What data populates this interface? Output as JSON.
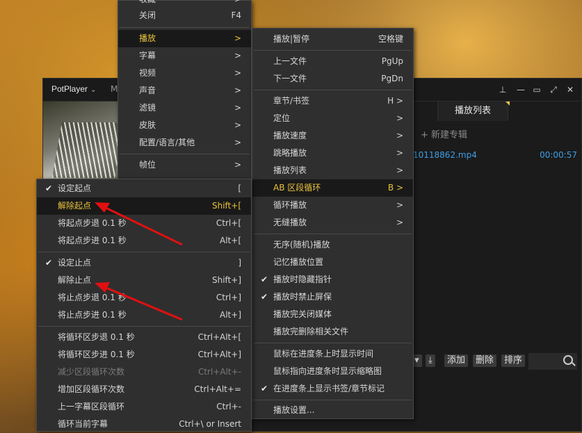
{
  "player": {
    "app_name": "PotPlayer",
    "m_tab": "M",
    "playlist_tab": "播放列表",
    "new_album": "+ 新建专辑",
    "item": {
      "name": "10118862.mp4",
      "duration": "00:00:57"
    },
    "toolbar": {
      "add": "添加",
      "delete": "删除",
      "sort": "排序"
    }
  },
  "main_menu": {
    "items": [
      {
        "label": "收藏",
        "key": ">"
      },
      {
        "label": "关闭",
        "key": "F4"
      },
      {
        "label": "播放",
        "key": ">"
      },
      {
        "label": "字幕",
        "key": ">"
      },
      {
        "label": "视频",
        "key": ">"
      },
      {
        "label": "声音",
        "key": ">"
      },
      {
        "label": "滤镜",
        "key": ">"
      },
      {
        "label": "皮肤",
        "key": ">"
      },
      {
        "label": "配置/语言/其他",
        "key": ">"
      },
      {
        "label": "帧位",
        "key": ">"
      }
    ]
  },
  "play_menu": {
    "items": [
      {
        "label": "播放|暂停",
        "key": "空格键"
      },
      {
        "label": "上一文件",
        "key": "PgUp"
      },
      {
        "label": "下一文件",
        "key": "PgDn"
      },
      {
        "label": "章节/书签",
        "key": "H >"
      },
      {
        "label": "定位",
        "key": ">"
      },
      {
        "label": "播放速度",
        "key": ">"
      },
      {
        "label": "跳略播放",
        "key": ">"
      },
      {
        "label": "播放列表",
        "key": ">"
      },
      {
        "label": "AB 区段循环",
        "key": "B >"
      },
      {
        "label": "循环播放",
        "key": ">"
      },
      {
        "label": "无缝播放",
        "key": ">"
      },
      {
        "label": "无序(随机)播放",
        "key": ""
      },
      {
        "label": "记忆播放位置",
        "key": ""
      },
      {
        "label": "播放时隐藏指针",
        "key": ""
      },
      {
        "label": "播放时禁止屏保",
        "key": ""
      },
      {
        "label": "播放完关闭媒体",
        "key": ""
      },
      {
        "label": "播放完删除相关文件",
        "key": ""
      },
      {
        "label": "鼠标在进度条上时显示时间",
        "key": ""
      },
      {
        "label": "鼠标指向进度条时显示缩略图",
        "key": ""
      },
      {
        "label": "在进度条上显示书签/章节标记",
        "key": ""
      },
      {
        "label": "播放设置...",
        "key": ""
      }
    ]
  },
  "ab_menu": {
    "items": [
      {
        "label": "设定起点",
        "key": "["
      },
      {
        "label": "解除起点",
        "key": "Shift+["
      },
      {
        "label": "将起点步退 0.1 秒",
        "key": "Ctrl+["
      },
      {
        "label": "将起点步进 0.1 秒",
        "key": "Alt+["
      },
      {
        "label": "设定止点",
        "key": "]"
      },
      {
        "label": "解除止点",
        "key": "Shift+]"
      },
      {
        "label": "将止点步退 0.1 秒",
        "key": "Ctrl+]"
      },
      {
        "label": "将止点步进 0.1 秒",
        "key": "Alt+]"
      },
      {
        "label": "将循环区步退 0.1 秒",
        "key": "Ctrl+Alt+["
      },
      {
        "label": "将循环区步进 0.1 秒",
        "key": "Ctrl+Alt+]"
      },
      {
        "label": "减少区段循环次数",
        "key": "Ctrl+Alt+-"
      },
      {
        "label": "增加区段循环次数",
        "key": "Ctrl+Alt+="
      },
      {
        "label": "上一字幕区段循环",
        "key": "Ctrl+-"
      },
      {
        "label": "循环当前字幕",
        "key": "Ctrl+\\ or Insert"
      }
    ]
  },
  "colors": {
    "highlight_text": "#e9c33d",
    "arrow": "#e01010",
    "playlist_text": "#3f9fe6"
  },
  "icons": [
    "checkmark-icon",
    "pin-icon",
    "minimize-icon",
    "maximize-icon",
    "restore-icon",
    "close-icon",
    "search-icon",
    "chevron-right-icon"
  ]
}
